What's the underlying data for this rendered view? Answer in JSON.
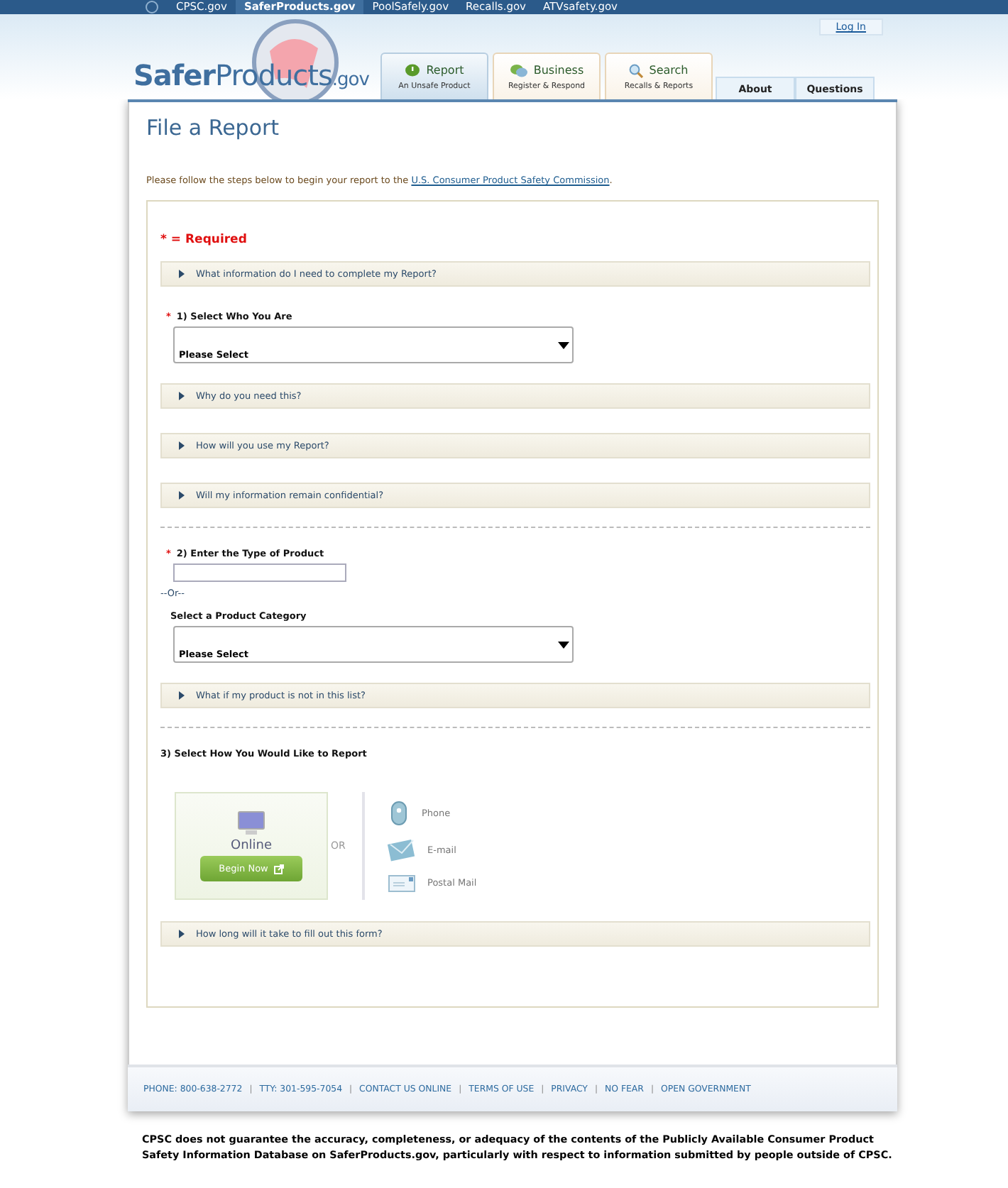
{
  "top_nav": [
    {
      "label": "CPSC.gov",
      "selected": false
    },
    {
      "label": "SaferProducts.gov",
      "selected": true
    },
    {
      "label": "PoolSafely.gov",
      "selected": false
    },
    {
      "label": "Recalls.gov",
      "selected": false
    },
    {
      "label": "ATVsafety.gov",
      "selected": false
    }
  ],
  "login": "Log In",
  "logo": {
    "first": "Safer",
    "second": "Products",
    "suffix": ".gov"
  },
  "main_tabs": [
    {
      "kind": "report",
      "title": "Report",
      "subtitle": "An Unsafe Product",
      "selected": true
    },
    {
      "kind": "business",
      "title": "Business",
      "subtitle": "Register & Respond",
      "selected": false
    },
    {
      "kind": "search",
      "title": "Search",
      "subtitle": "Recalls & Reports",
      "selected": false
    }
  ],
  "side_tabs": [
    "About",
    "Questions"
  ],
  "page_title": "File a Report",
  "intro": {
    "text": "Please follow the steps below to begin your report to the ",
    "link": "U.S. Consumer Product Safety Commission",
    "end": "."
  },
  "required_note": {
    "mark": "*",
    "text": "= Required"
  },
  "form": [
    {
      "kind": "accordion",
      "label": "What information do I need to complete my Report?"
    },
    {
      "kind": "question",
      "required": true,
      "label": "1) Select Who You Are"
    },
    {
      "kind": "select",
      "value": "Please Select"
    },
    {
      "kind": "accordion",
      "label": "Why do you need this?"
    },
    {
      "kind": "accordion",
      "label": "How will you use my Report?"
    },
    {
      "kind": "accordion",
      "label": "Will my information remain confidential?"
    },
    {
      "kind": "divider"
    },
    {
      "kind": "question",
      "required": true,
      "label": "2) Enter the Type of Product"
    },
    {
      "kind": "input"
    },
    {
      "kind": "or",
      "label": "--Or--"
    },
    {
      "kind": "sublabel",
      "label": "Select a Product Category"
    },
    {
      "kind": "select",
      "value": "Please Select"
    },
    {
      "kind": "accordion",
      "label": "What if my product is not in this list?"
    },
    {
      "kind": "divider"
    },
    {
      "kind": "question",
      "required": false,
      "label": "3) Select How You Would Like to Report"
    },
    {
      "kind": "methods"
    },
    {
      "kind": "accordion",
      "label": "How long will it take to fill out this form?"
    }
  ],
  "methods": {
    "online": {
      "title": "Online",
      "button": "Begin Now"
    },
    "or": "OR",
    "others": [
      {
        "kind": "phone",
        "label": "Phone"
      },
      {
        "kind": "email",
        "label": "E-mail"
      },
      {
        "kind": "postal",
        "label": "Postal Mail"
      }
    ]
  },
  "footer": {
    "separator": "|",
    "links": [
      "PHONE: 800-638-2772",
      "TTY: 301-595-7054",
      "CONTACT US ONLINE",
      "TERMS OF USE",
      "PRIVACY",
      "NO FEAR",
      "OPEN GOVERNMENT"
    ]
  },
  "disclaimer": "CPSC does not guarantee the accuracy, completeness, or adequacy of the contents of the Publicly Available Consumer Product Safety Information Database on SaferProducts.gov, particularly with respect to information submitted by people outside of CPSC."
}
